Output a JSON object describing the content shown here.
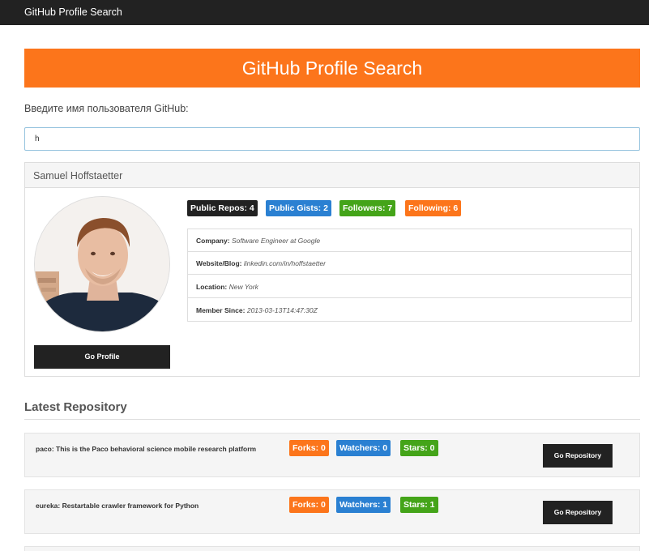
{
  "navbar": {
    "brand": "GitHub Profile Search"
  },
  "hero": {
    "title": "GitHub Profile Search"
  },
  "search": {
    "label": "Введите имя пользователя GitHub:",
    "value": "h"
  },
  "profile": {
    "name": "Samuel Hoffstaetter",
    "avatar_icon": "user-photo",
    "go_profile_label": "Go Profile",
    "badges": {
      "public_repos": "Public Repos: 4",
      "public_gists": "Public Gists: 2",
      "followers": "Followers: 7",
      "following": "Following: 6"
    },
    "info": {
      "company_label": "Company:",
      "company_value": "Software Engineer at Google",
      "website_label": "Website/Blog:",
      "website_value": "linkedin.com/in/hoffstaetter",
      "location_label": "Location:",
      "location_value": "New York",
      "member_label": "Member Since:",
      "member_value": "2013-03-13T14:47:30Z"
    }
  },
  "repos_section": {
    "title": "Latest Repository"
  },
  "repos": [
    {
      "name": "paco: This is the Paco behavioral science mobile research platform",
      "forks": "Forks: 0",
      "watchers": "Watchers: 0",
      "stars": "Stars: 0",
      "button": "Go Repository"
    },
    {
      "name": "eureka: Restartable crawler framework for Python",
      "forks": "Forks: 0",
      "watchers": "Watchers: 1",
      "stars": "Stars: 1",
      "button": "Go Repository"
    }
  ],
  "colors": {
    "accent": "#fc751b",
    "navbar": "#222222",
    "badge_blue": "#2a80d2",
    "badge_green": "#44a419"
  }
}
